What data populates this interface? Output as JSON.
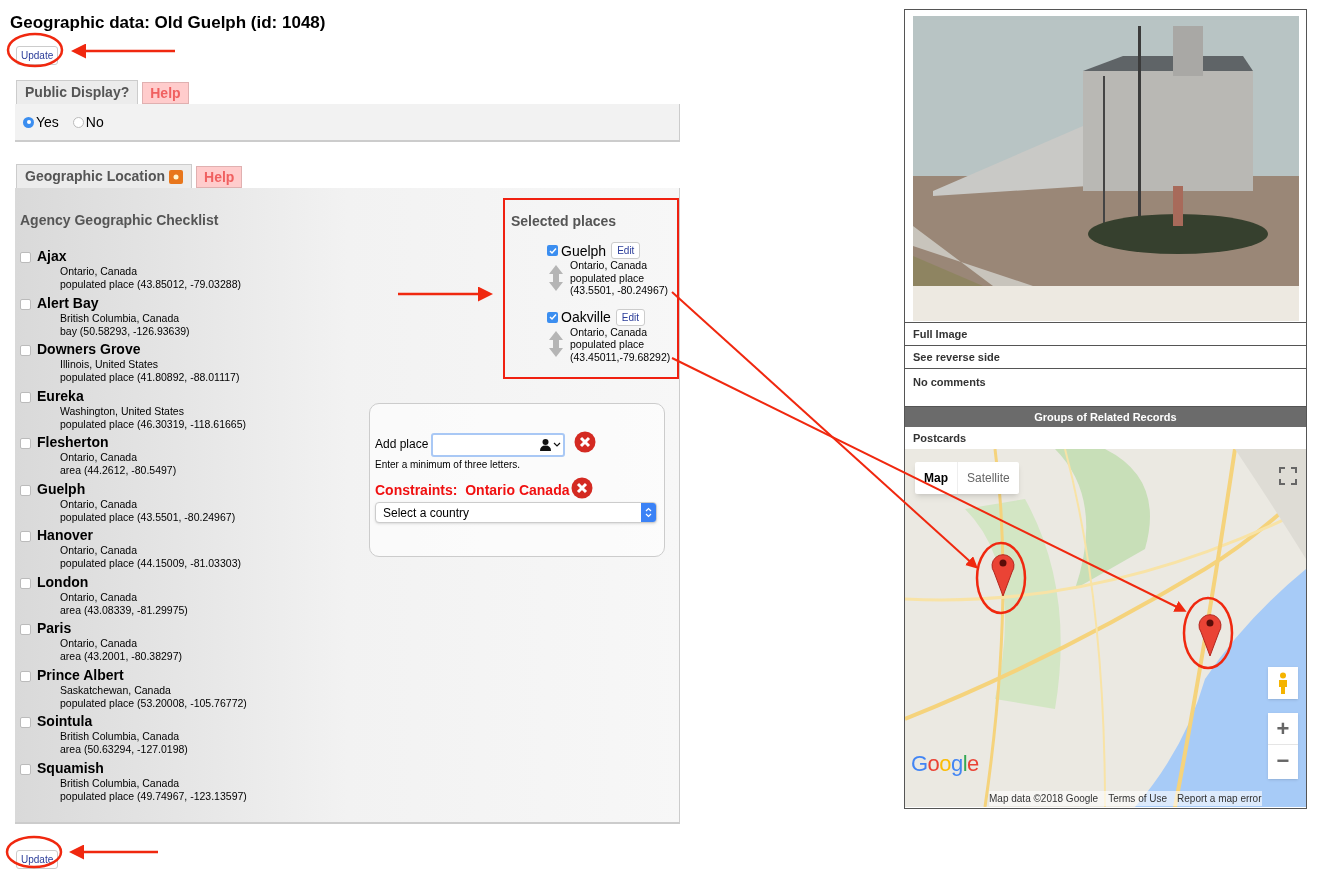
{
  "page": {
    "title": "Geographic data: Old Guelph (id: 1048)"
  },
  "update_buttons": [
    "Update",
    "Update"
  ],
  "public_display": {
    "tabs": [
      {
        "label": "Public Display?",
        "selected": true
      },
      {
        "label": "Help",
        "selected": false
      }
    ],
    "options": [
      {
        "label": "Yes",
        "selected": true
      },
      {
        "label": "No",
        "selected": false
      }
    ]
  },
  "geographic_location": {
    "tabs": [
      {
        "label": "Geographic Location",
        "selected": true
      },
      {
        "label": "Help",
        "selected": false
      }
    ],
    "checklist": {
      "title": "Agency Geographic Checklist",
      "items": [
        {
          "name": "Ajax",
          "region": "Ontario, Canada",
          "detail": "populated place (43.85012, -79.03288)",
          "checked": false
        },
        {
          "name": "Alert Bay",
          "region": "British Columbia, Canada",
          "detail": "bay (50.58293, -126.93639)",
          "checked": false
        },
        {
          "name": "Downers Grove",
          "region": "Illinois, United States",
          "detail": "populated place (41.80892, -88.01117)",
          "checked": false
        },
        {
          "name": "Eureka",
          "region": "Washington, United States",
          "detail": "populated place (46.30319, -118.61665)",
          "checked": false
        },
        {
          "name": "Flesherton",
          "region": "Ontario, Canada",
          "detail": "area (44.2612, -80.5497)",
          "checked": false
        },
        {
          "name": "Guelph",
          "region": "Ontario, Canada",
          "detail": "populated place (43.5501, -80.24967)",
          "checked": false
        },
        {
          "name": "Hanover",
          "region": "Ontario, Canada",
          "detail": "populated place (44.15009, -81.03303)",
          "checked": false
        },
        {
          "name": "London",
          "region": "Ontario, Canada",
          "detail": "area (43.08339, -81.29975)",
          "checked": false
        },
        {
          "name": "Paris",
          "region": "Ontario, Canada",
          "detail": "area (43.2001, -80.38297)",
          "checked": false
        },
        {
          "name": "Prince Albert",
          "region": "Saskatchewan, Canada",
          "detail": "populated place (53.20008, -105.76772)",
          "checked": false
        },
        {
          "name": "Sointula",
          "region": "British Columbia, Canada",
          "detail": "area (50.63294, -127.0198)",
          "checked": false
        },
        {
          "name": "Squamish",
          "region": "British Columbia, Canada",
          "detail": "populated place (49.74967, -123.13597)",
          "checked": false
        }
      ]
    },
    "selected_places": {
      "title": "Selected places",
      "items": [
        {
          "name": "Guelph",
          "checked": true,
          "edit": "Edit",
          "region": "Ontario, Canada",
          "type": "populated place",
          "coords": "(43.5501, -80.24967)"
        },
        {
          "name": "Oakville",
          "checked": true,
          "edit": "Edit",
          "region": "Ontario, Canada",
          "type": "populated place",
          "coords": "(43.45011,-79.68292)"
        }
      ]
    },
    "add_place": {
      "label": "Add place",
      "hint": "Enter a minimum of three letters.",
      "constraints_label": "Constraints:",
      "constraints_value": "Ontario Canada",
      "country_select": "Select a country"
    }
  },
  "record_panel": {
    "links": [
      "Full Image",
      "See reverse side"
    ],
    "comments": "No comments",
    "related_header": "Groups of Related Records",
    "related": [
      "Postcards"
    ],
    "map": {
      "map_types": [
        {
          "label": "Map",
          "selected": true
        },
        {
          "label": "Satellite",
          "selected": false
        }
      ],
      "zoom_in": "+",
      "zoom_out": "−",
      "logo": "Google",
      "attribution": "Map data ©2018 Google",
      "terms": "Terms of Use",
      "report": "Report a map error"
    }
  }
}
